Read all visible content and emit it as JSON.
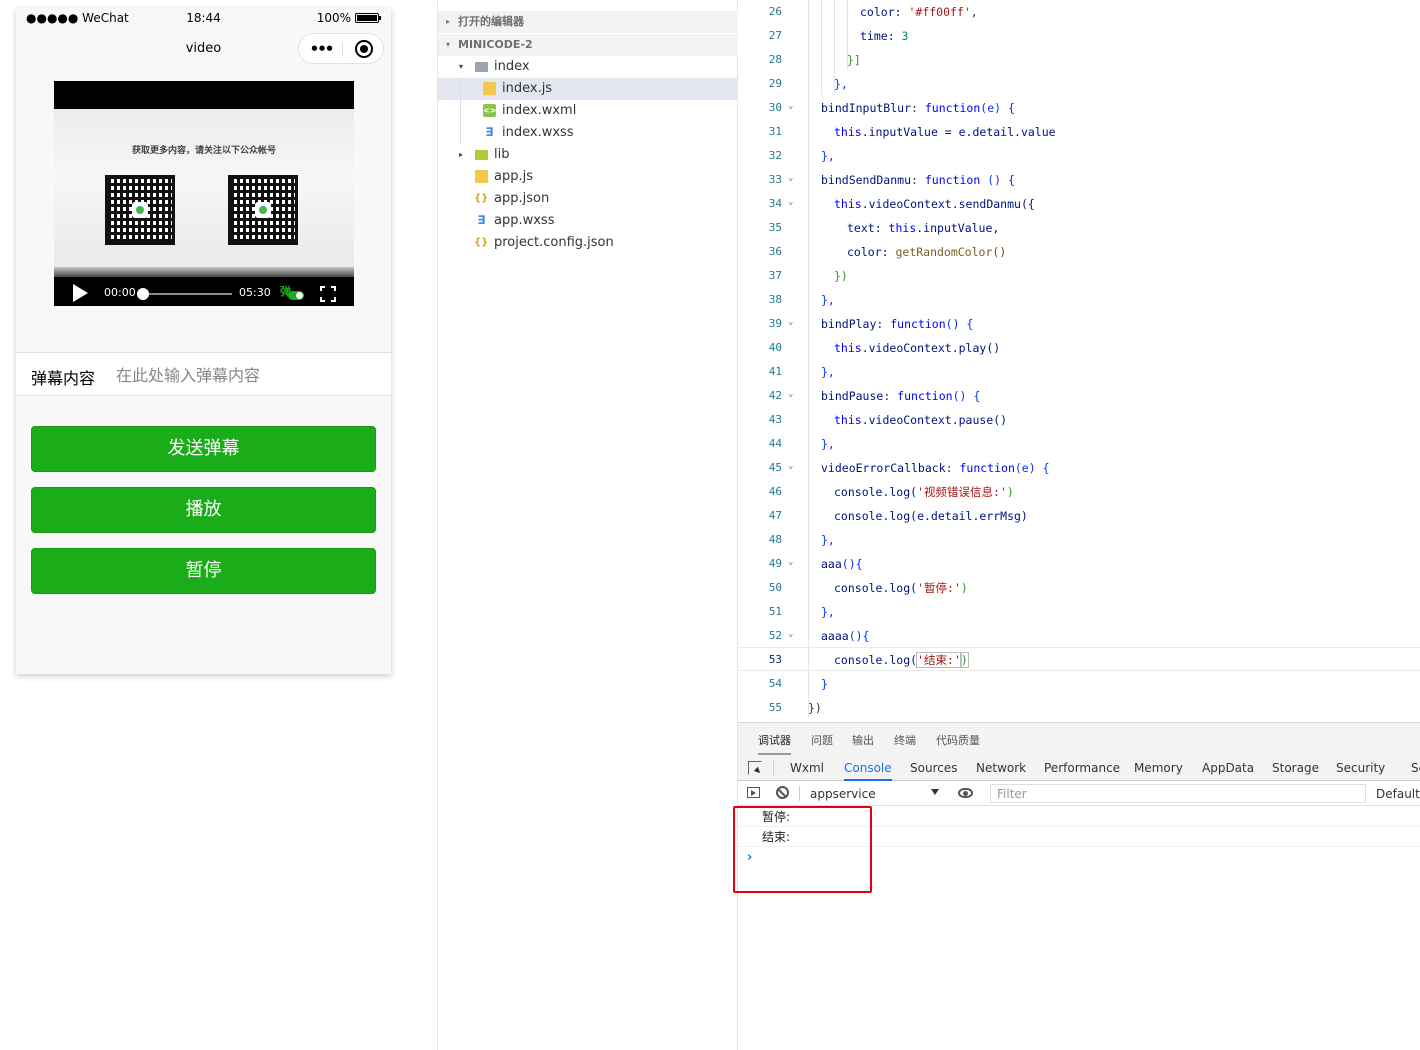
{
  "simulator": {
    "status": {
      "signal": "●●●●● WeChat",
      "time": "18:44",
      "battery": "100%"
    },
    "nav": {
      "title": "video"
    },
    "video": {
      "overlay_text": "获取更多内容，请关注以下公众帐号",
      "current_time": "00:00",
      "duration": "05:30",
      "danmu_toggle_label": "弹",
      "progress": 0.0
    },
    "danmu": {
      "label": "弹幕内容",
      "placeholder": "在此处输入弹幕内容"
    },
    "buttons": {
      "send": "发送弹幕",
      "play": "播放",
      "pause": "暂停"
    },
    "colors": {
      "primary_button": "#1aad19"
    }
  },
  "explorer": {
    "open_editors": "打开的编辑器",
    "project": "MINICODE-2",
    "items": [
      {
        "label": "index",
        "icon": "folder-icon"
      },
      {
        "label": "index.js",
        "icon": "js-file-icon"
      },
      {
        "label": "index.wxml",
        "icon": "wxml-file-icon"
      },
      {
        "label": "index.wxss",
        "icon": "wxss-file-icon"
      },
      {
        "label": "lib",
        "icon": "folder-icon"
      },
      {
        "label": "app.js",
        "icon": "js-file-icon"
      },
      {
        "label": "app.json",
        "icon": "json-file-icon"
      },
      {
        "label": "app.wxss",
        "icon": "wxss-file-icon"
      },
      {
        "label": "project.config.json",
        "icon": "json-file-icon"
      }
    ],
    "selected": "index.js"
  },
  "editor": {
    "lines": [
      {
        "n": "26",
        "t": [
          "color: ",
          "'#ff00ff'",
          ","
        ]
      },
      {
        "n": "27",
        "t": [
          "time: ",
          "3"
        ]
      },
      {
        "n": "28",
        "t": [
          "}]"
        ]
      },
      {
        "n": "29",
        "t": [
          "},"
        ]
      },
      {
        "n": "30",
        "t": [
          "bindInputBlur",
          ": ",
          "function",
          "(e) {"
        ]
      },
      {
        "n": "31",
        "t": [
          "this",
          ".inputValue = e.detail.value"
        ]
      },
      {
        "n": "32",
        "t": [
          "},"
        ]
      },
      {
        "n": "33",
        "t": [
          "bindSendDanmu",
          ": ",
          "function",
          " () {"
        ]
      },
      {
        "n": "34",
        "t": [
          "this",
          ".videoContext.sendDanmu({"
        ]
      },
      {
        "n": "35",
        "t": [
          "text: ",
          "this",
          ".inputValue,"
        ]
      },
      {
        "n": "36",
        "t": [
          "color: ",
          "getRandomColor",
          "()"
        ]
      },
      {
        "n": "37",
        "t": [
          "})"
        ]
      },
      {
        "n": "38",
        "t": [
          "},"
        ]
      },
      {
        "n": "39",
        "t": [
          "bindPlay",
          ": ",
          "function",
          "() {"
        ]
      },
      {
        "n": "40",
        "t": [
          "this",
          ".videoContext.play()"
        ]
      },
      {
        "n": "41",
        "t": [
          "},"
        ]
      },
      {
        "n": "42",
        "t": [
          "bindPause",
          ": ",
          "function",
          "() {"
        ]
      },
      {
        "n": "43",
        "t": [
          "this",
          ".videoContext.pause()"
        ]
      },
      {
        "n": "44",
        "t": [
          "},"
        ]
      },
      {
        "n": "45",
        "t": [
          "videoErrorCallback",
          ": ",
          "function",
          "(e) {"
        ]
      },
      {
        "n": "46",
        "t": [
          "console.log(",
          "'视频错误信息:'",
          ")"
        ]
      },
      {
        "n": "47",
        "t": [
          "console.log(e.detail.errMsg)"
        ]
      },
      {
        "n": "48",
        "t": [
          "},"
        ]
      },
      {
        "n": "49",
        "t": [
          "aaa",
          "(){"
        ]
      },
      {
        "n": "50",
        "t": [
          "console.log(",
          "'暂停:'",
          ")"
        ]
      },
      {
        "n": "51",
        "t": [
          "},"
        ]
      },
      {
        "n": "52",
        "t": [
          "aaaa",
          "(){"
        ]
      },
      {
        "n": "53",
        "t": [
          "console.log(",
          "'结束:'",
          ")"
        ]
      },
      {
        "n": "54",
        "t": [
          "}"
        ]
      },
      {
        "n": "55",
        "t": [
          "})"
        ]
      }
    ]
  },
  "debugger": {
    "panel_tabs": [
      "调试器",
      "问题",
      "输出",
      "终端",
      "代码质量"
    ],
    "active_panel": "调试器",
    "devtools_tabs": [
      "Wxml",
      "Console",
      "Sources",
      "Network",
      "Performance",
      "Memory",
      "AppData",
      "Storage",
      "Security",
      "Se"
    ],
    "active_devtools_tab": "Console",
    "context": "appservice",
    "filter_placeholder": "Filter",
    "levels": "Default l",
    "console_messages": [
      "暂停:",
      "结束:"
    ],
    "prompt": "›",
    "highlight_color": "#e60012"
  }
}
